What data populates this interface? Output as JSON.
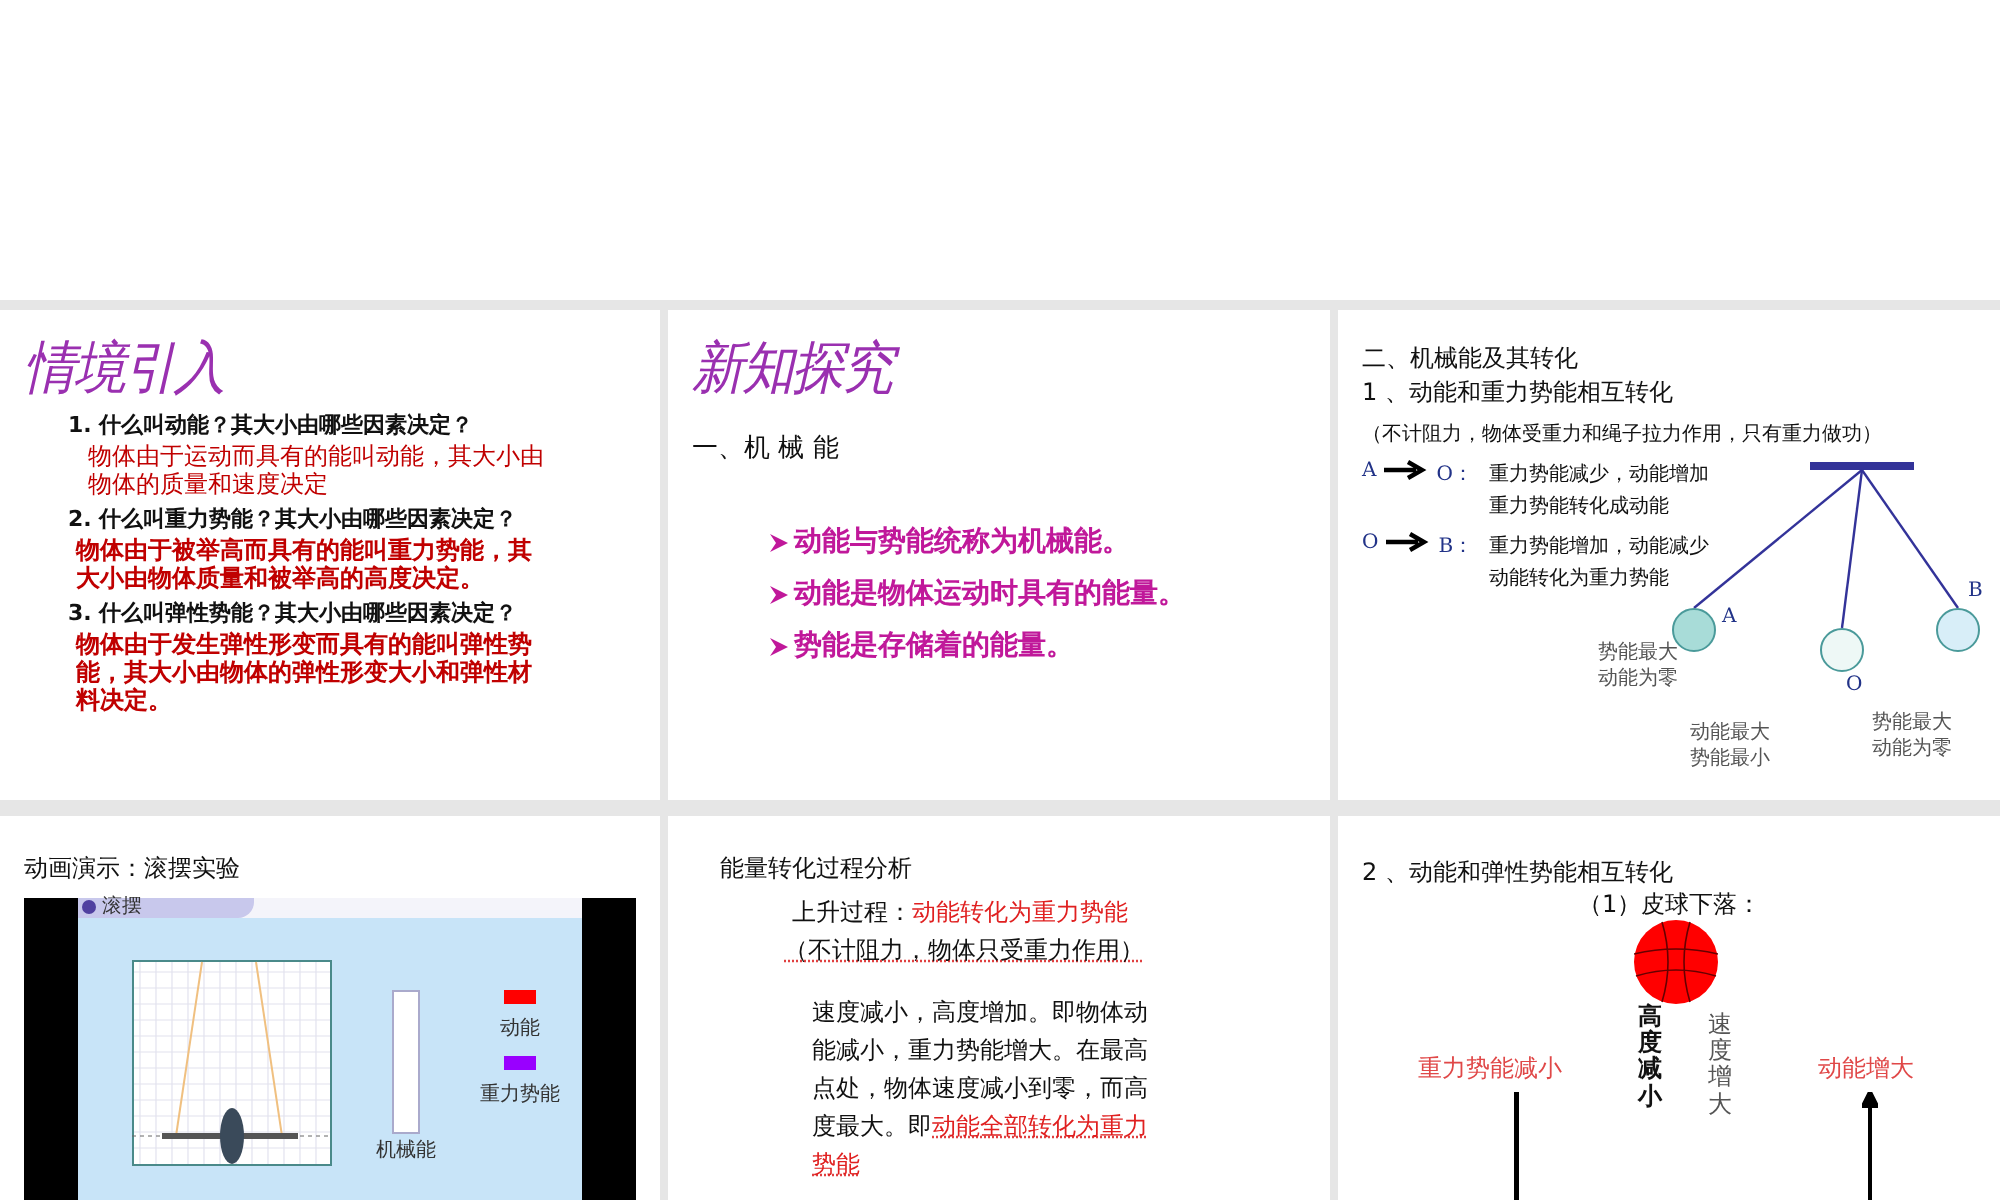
{
  "slides": [
    {
      "kind": "intro",
      "title": "情境引入",
      "items": [
        {
          "question": "1. 什么叫动能？其大小由哪些因素决定？",
          "answer": "物体由于运动而具有的能叫动能，其大小由物体的质量和速度决定",
          "bold": false
        },
        {
          "question": "2. 什么叫重力势能？其大小由哪些因素决定？",
          "answer": "物体由于被举高而具有的能叫重力势能，其大小由物体质量和被举高的高度决定。",
          "bold": true
        },
        {
          "question": "3. 什么叫弹性势能？其大小由哪些因素决定？",
          "answer": "物体由于发生弹性形变而具有的能叫弹性势能，其大小由物体的弹性形变大小和弹性材料决定。",
          "bold": true
        }
      ]
    },
    {
      "kind": "concepts",
      "title": "新知探究",
      "heading": "一、机 械 能",
      "bullets": [
        "动能与势能统称为机械能。",
        "动能是物体运动时具有的能量。",
        "势能是存储着的能量。"
      ]
    },
    {
      "kind": "pendulum",
      "heading": "二、机械能及其转化",
      "subheading": "1 、动能和重力势能相互转化",
      "note": "（不计阻力，物体受重力和绳子拉力作用，只有重力做功）",
      "transitions": [
        {
          "from": "A",
          "to": "O：",
          "lines": [
            "重力势能减少，动能增加",
            "重力势能转化成动能"
          ]
        },
        {
          "from": "O",
          "to": "B：",
          "lines": [
            "重力势能增加，动能减少",
            "动能转化为重力势能"
          ]
        }
      ],
      "bobs": [
        {
          "label": "A",
          "color": "#a8dcd8",
          "caption": [
            "势能最大",
            "动能为零"
          ]
        },
        {
          "label": "O",
          "color": "#eef8f6",
          "caption": [
            "动能最大",
            "势能最小"
          ]
        },
        {
          "label": "B",
          "color": "#d8eef8",
          "caption": [
            "势能最大",
            "动能为零"
          ]
        }
      ]
    },
    {
      "kind": "animation",
      "title": "动画演示：滚摆实验",
      "window_title": "滚摆",
      "bar_label": "机械能",
      "legend": [
        {
          "label": "动能",
          "color": "#ff0000"
        },
        {
          "label": "重力势能",
          "color": "#9900ff"
        }
      ]
    },
    {
      "kind": "analysis",
      "title": "能量转化过程分析",
      "process": {
        "label": "上升过程：",
        "highlight": "动能转化为重力势能"
      },
      "note": "（不计阻力，物体只受重力作用）",
      "paragraph": {
        "text": "速度减小，高度增加。即物体动能减小，重力势能增大。在最高点处，物体速度减小到零，而高度最大。即",
        "highlight": "动能全部转化为重力势能"
      }
    },
    {
      "kind": "ball",
      "heading": "2 、动能和弹性势能相互转化",
      "subheading": "（1）皮球下落：",
      "height_label": "高度减小",
      "speed_label": "速度增大",
      "left_label": "重力势能减小",
      "right_label": "动能增大"
    }
  ]
}
